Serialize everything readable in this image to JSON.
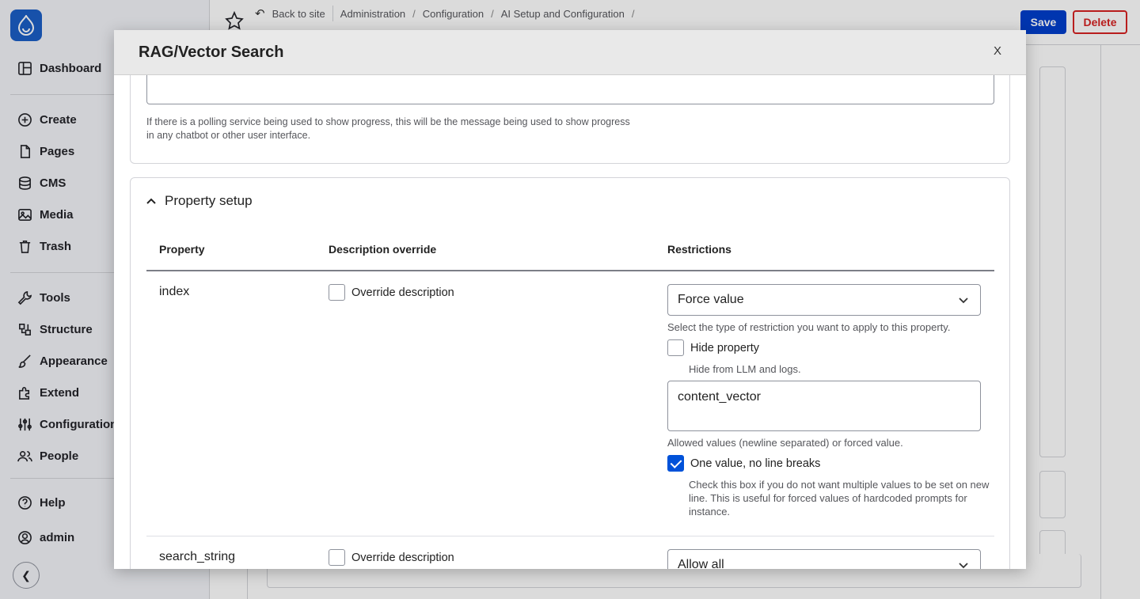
{
  "topbar": {
    "back_label": "Back to site",
    "breadcrumbs": [
      "Administration",
      "Configuration",
      "AI Setup and Configuration"
    ],
    "save_label": "Save",
    "delete_label": "Delete"
  },
  "sidebar": {
    "items": [
      {
        "label": "Dashboard",
        "icon": "dashboard-icon"
      },
      {
        "label": "Create",
        "icon": "plus-circle-icon"
      },
      {
        "label": "Pages",
        "icon": "file-icon"
      },
      {
        "label": "CMS",
        "icon": "database-icon"
      },
      {
        "label": "Media",
        "icon": "image-icon"
      },
      {
        "label": "Trash",
        "icon": "trash-icon"
      },
      {
        "label": "Tools",
        "icon": "wrench-icon"
      },
      {
        "label": "Structure",
        "icon": "structure-icon"
      },
      {
        "label": "Appearance",
        "icon": "brush-icon"
      },
      {
        "label": "Extend",
        "icon": "puzzle-icon"
      },
      {
        "label": "Configuration",
        "icon": "sliders-icon"
      },
      {
        "label": "People",
        "icon": "people-icon"
      }
    ],
    "footer": [
      {
        "label": "Help",
        "icon": "help-icon"
      },
      {
        "label": "admin",
        "icon": "user-icon"
      }
    ]
  },
  "modal": {
    "title": "RAG/Vector Search",
    "close_label": "X",
    "progress_help": "If there is a polling service being used to show progress, this will be the message being used to show progress in any chatbot or other user interface.",
    "section_title": "Property setup",
    "table": {
      "headers": [
        "Property",
        "Description override",
        "Restrictions"
      ]
    },
    "rows": [
      {
        "property": "index",
        "override_label": "Override description",
        "restriction": "Force value",
        "restriction_help": "Select the type of restriction you want to apply to this property.",
        "hide_label": "Hide property",
        "hide_help": "Hide from LLM and logs.",
        "value": "content_vector",
        "value_help": "Allowed values (newline separated) or forced value.",
        "one_value_label": "One value, no line breaks",
        "one_value_help": "Check this box if you do not want multiple values to be set on new line. This is useful for forced values of hardcoded prompts for instance."
      },
      {
        "property": "search_string",
        "override_label": "Override description",
        "restriction": "Allow all"
      }
    ]
  }
}
